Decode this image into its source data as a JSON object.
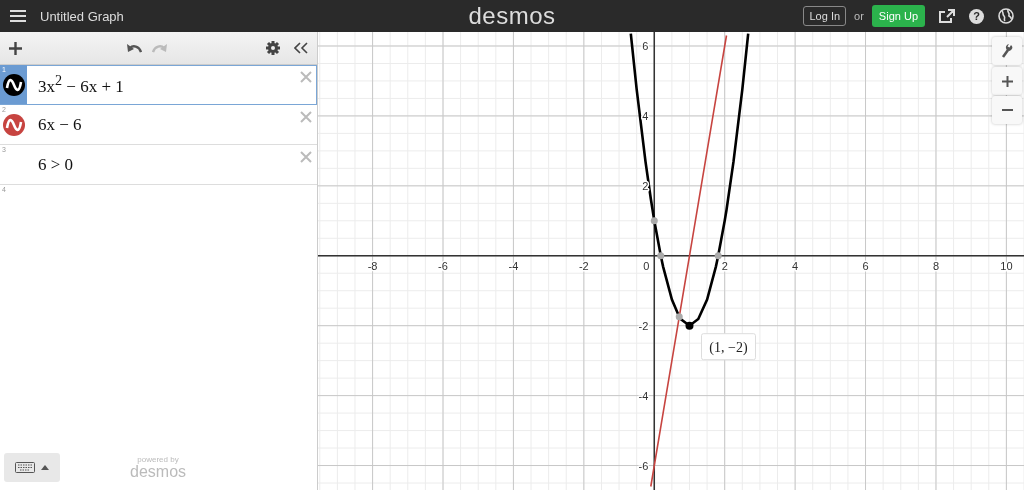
{
  "header": {
    "title": "Untitled Graph",
    "logo": "desmos",
    "login": "Log In",
    "or": "or",
    "signup": "Sign Up",
    "help": "?"
  },
  "expressions": [
    {
      "number": "1",
      "kind": "graph",
      "text": "3x$^{2}$ − 6x + 1",
      "color": "#000000",
      "selected": true
    },
    {
      "number": "2",
      "kind": "graph",
      "text": "6x − 6",
      "color": "#c74440",
      "selected": false
    },
    {
      "number": "3",
      "kind": "statement",
      "text": "6 > 0",
      "selected": false
    },
    {
      "number": "4",
      "kind": "empty",
      "selected": false
    }
  ],
  "footer": {
    "powered": "powered by",
    "brand": "desmos"
  },
  "graph": {
    "origin_label": "0",
    "chart_data": {
      "type": "line",
      "x": [
        -0.67,
        -0.5,
        -0.25,
        -0.1,
        0,
        0.19,
        0.25,
        0.5,
        0.71,
        0.75,
        1,
        1.25,
        1.5,
        1.75,
        1.81,
        2,
        2.05,
        2.25,
        2.5,
        2.67
      ],
      "series": [
        {
          "color": "#000000",
          "values": [
            6.37,
            4.75,
            2.69,
            1.63,
            1,
            -0.03,
            -0.31,
            -1.25,
            -1.75,
            -1.81,
            -2,
            -1.81,
            -1.25,
            -0.31,
            -0.03,
            1,
            1.31,
            2.69,
            4.75,
            6.37
          ]
        },
        {
          "color": "#c74440",
          "values": [
            null,
            null,
            null,
            -6.6,
            -6,
            -4.86,
            -4.5,
            -3,
            -1.74,
            -1.5,
            0,
            1.5,
            3,
            4.5,
            4.86,
            6,
            6.3,
            null,
            null,
            null
          ]
        }
      ],
      "xlim": [
        -9.55,
        10.5
      ],
      "ylim": [
        -6.7,
        6.4
      ],
      "xticks": [
        -8,
        -6,
        -4,
        -2,
        2,
        4,
        6,
        8,
        10
      ],
      "yticks": [
        -6,
        -4,
        -2,
        2,
        4,
        6
      ],
      "grid": true,
      "annotations": [
        {
          "x": 1,
          "y": -2,
          "text": "(1, −2)"
        }
      ]
    }
  }
}
